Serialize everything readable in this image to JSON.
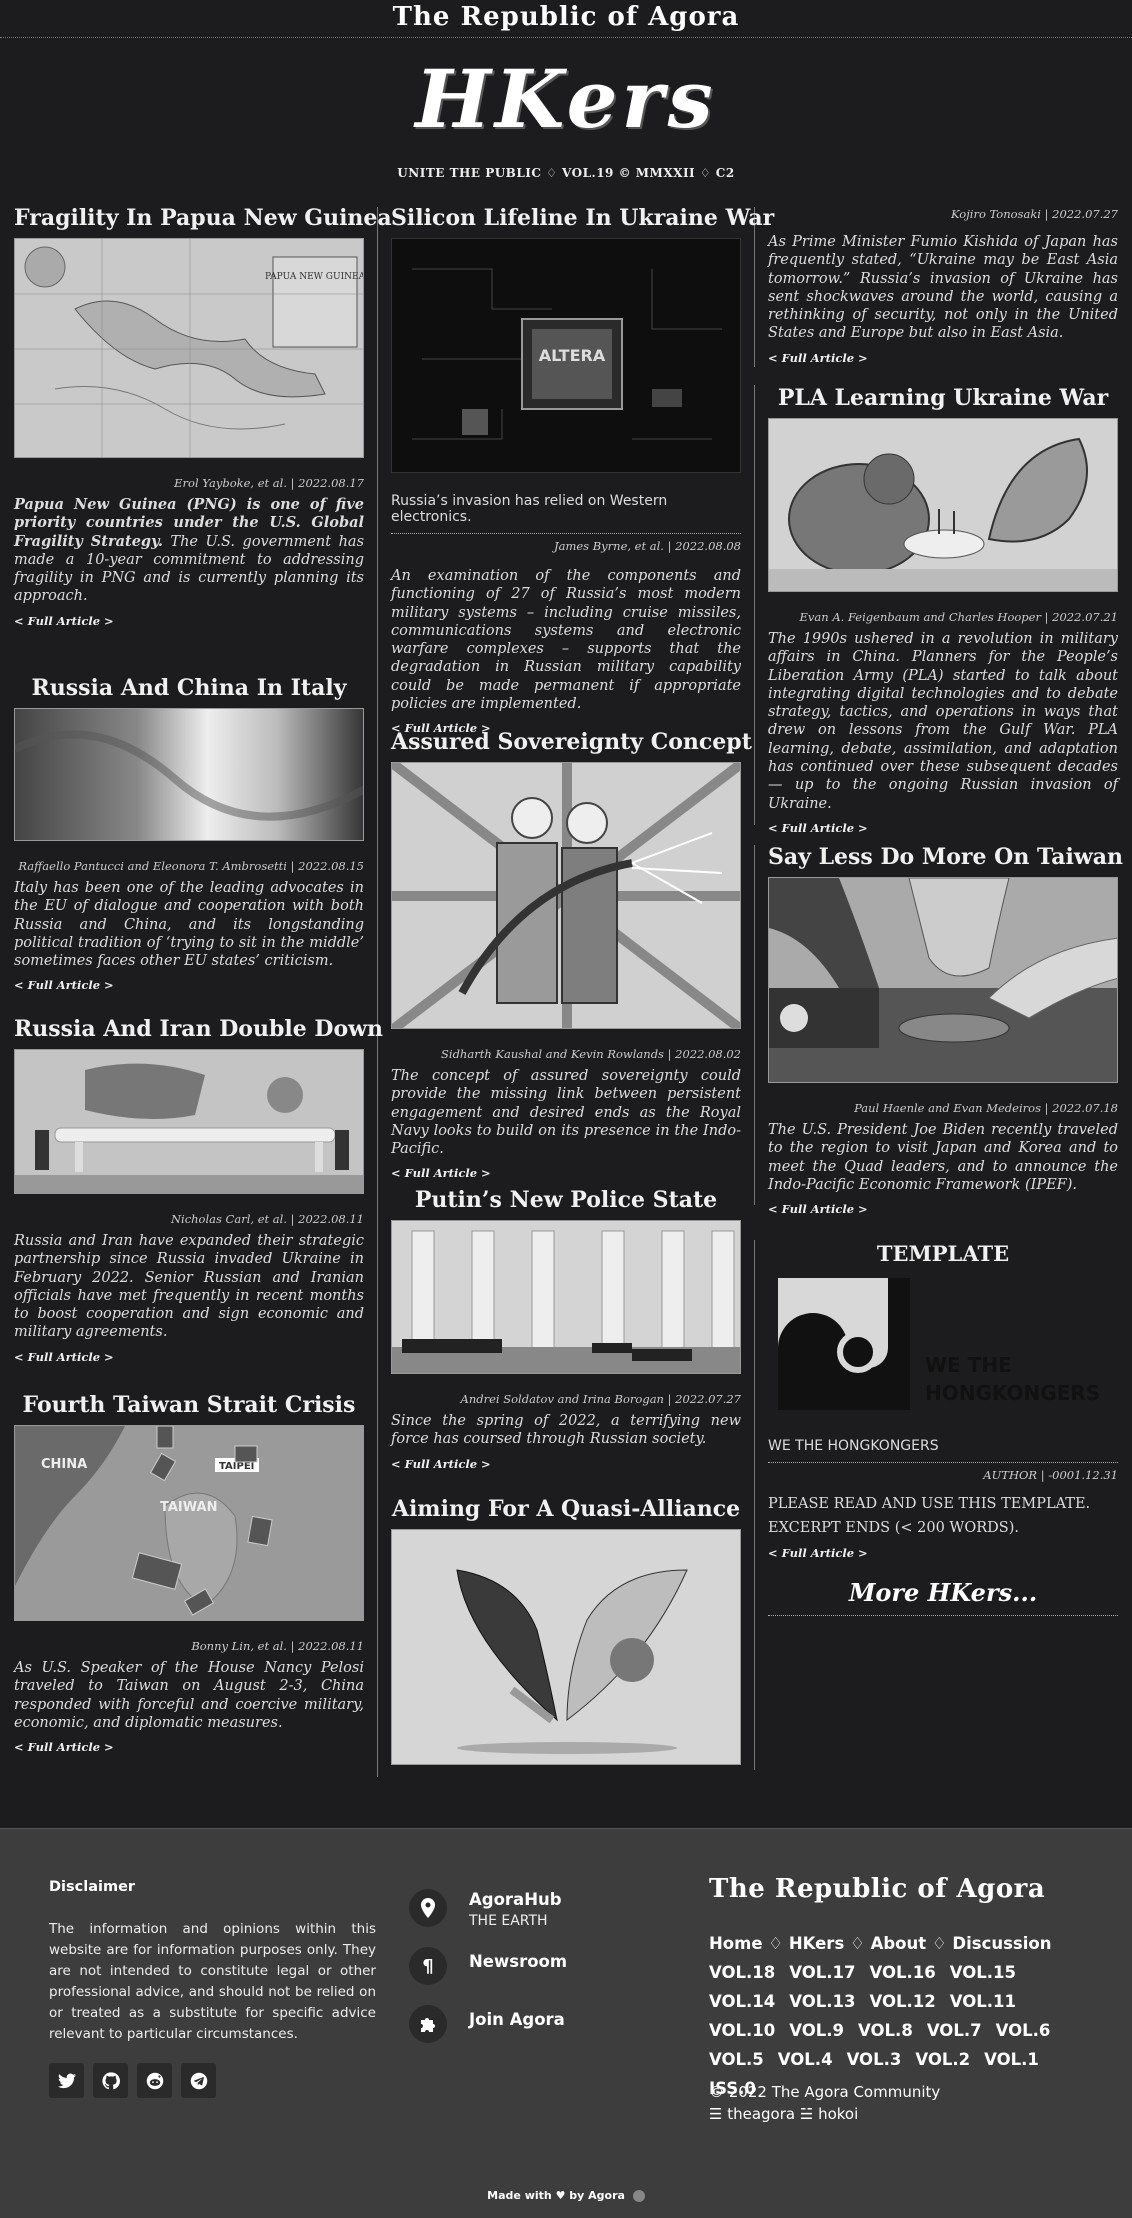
{
  "masthead": "The Republic of Agora",
  "logo": "HKers",
  "tagline": "UNITE THE PUBLIC ♢ VOL.19 © MMXXII ♢ C2",
  "full_article": "< Full Article >",
  "articles": {
    "a1": {
      "title": "Fragility In Papua New Guinea",
      "meta": "Erol Yayboke, et al. | 2022.08.17",
      "lead": "Papua New Guinea (PNG) is one of five priority countries under the U.S. Global Fragility Strategy.",
      "excerpt": "The U.S. government has made a 10-year commitment to addressing fragility in PNG and is currently planning its approach.",
      "map_title": "PAPUA NEW GUINEA"
    },
    "a2": {
      "title": "Russia And China In Italy",
      "meta": "Raffaello Pantucci and Eleonora T. Ambrosetti | 2022.08.15",
      "excerpt": "Italy has been one of the leading advocates in the EU of dialogue and cooperation with both Russia and China, and its longstanding political tradition of ‘trying to sit in the middle’ sometimes faces other EU states’ criticism."
    },
    "a3": {
      "title": "Russia And Iran Double Down",
      "meta": "Nicholas Carl, et al. | 2022.08.11",
      "excerpt": "Russia and Iran have expanded their strategic partnership since Russia invaded Ukraine in February 2022. Senior Russian and Iranian officials have met frequently in recent months to boost cooperation and sign economic and military agreements."
    },
    "a4": {
      "title": "Fourth Taiwan Strait Crisis",
      "meta": "Bonny Lin, et al. | 2022.08.11",
      "excerpt": "As U.S. Speaker of the House Nancy Pelosi traveled to Taiwan on August 2-3, China responded with forceful and coercive military, economic, and diplomatic measures.",
      "map_labels": [
        "CHINA",
        "TAIWAN",
        "TAIPEI"
      ]
    },
    "b1": {
      "title": "Silicon Lifeline In Ukraine War",
      "caption": "Russia’s invasion has relied on Western electronics.",
      "meta": "James Byrne, et al. | 2022.08.08",
      "excerpt": "An examination of the components and functioning of 27 of Russia’s most modern military systems – including cruise missiles, communications systems and electronic warfare complexes – supports that the degradation in Russian military capability could be made permanent if appropriate policies are implemented.",
      "chip_text": "ALTERA"
    },
    "b2": {
      "title": "Assured Sovereignty Concept",
      "meta": "Sidharth Kaushal and Kevin Rowlands | 2022.08.02",
      "excerpt": "The concept of assured sovereignty could provide the missing link between persistent engagement and desired ends as the Royal Navy looks to build on its presence in the Indo-Pacific."
    },
    "b3": {
      "title": "Putin’s New Police State",
      "meta": "Andrei Soldatov and Irina Borogan | 2022.07.27",
      "excerpt": "Since the spring of 2022, a terrifying new force has coursed through Russian society."
    },
    "b4": {
      "title": "Aiming For A Quasi-Alliance"
    },
    "c0": {
      "meta": "Kojiro Tonosaki | 2022.07.27",
      "excerpt": "As Prime Minister Fumio Kishida of Japan has frequently stated, “Ukraine may be East Asia tomorrow.” Russia’s invasion of Ukraine has sent shockwaves around the world, causing a rethinking of security, not only in the United States and Europe but also in East Asia."
    },
    "c1": {
      "title": "PLA Learning Ukraine War",
      "meta": "Evan A. Feigenbaum and Charles Hooper | 2022.07.21",
      "excerpt": "The 1990s ushered in a revolution in military affairs in China. Planners for the People’s Liberation Army (PLA) started to talk about integrating digital technologies and to debate strategy, tactics, and operations in ways that drew on lessons from the Gulf War. PLA learning, debate, assimilation, and adaptation has continued over these subsequent decades — up to the ongoing Russian invasion of Ukraine."
    },
    "c2": {
      "title": "Say Less Do More On Taiwan",
      "meta": "Paul Haenle and Evan Medeiros | 2022.07.18",
      "excerpt": "The U.S. President Joe Biden recently traveled to the region to visit Japan and Korea and to meet the Quad leaders, and to announce the Indo-Pacific Economic Framework (IPEF)."
    },
    "c3": {
      "title": "TEMPLATE",
      "logo_line1": "WE THE",
      "logo_line2": "HONGKONGERS",
      "caption": "WE THE HONGKONGERS",
      "meta": "AUTHOR | -0001.12.31",
      "body1": "PLEASE READ AND USE THIS TEMPLATE.",
      "body2": "EXCERPT ENDS (< 200 WORDS)."
    }
  },
  "more_hkers": "More HKers...",
  "footer": {
    "disclaimer_title": "Disclaimer",
    "disclaimer_text": "The information and opinions within this website are for information purposes only. They are not intended to constitute legal or other professional advice, and should not be relied on or treated as a substitute for specific advice relevant to particular circumstances.",
    "socials": [
      "twitter-icon",
      "github-icon",
      "reddit-icon",
      "telegram-icon"
    ],
    "hub": [
      {
        "title": "AgoraHub",
        "sub": "THE EARTH",
        "icon": "map-pin-icon"
      },
      {
        "title": "Newsroom",
        "icon": "pilcrow-icon"
      },
      {
        "title": "Join Agora",
        "icon": "puzzle-icon"
      }
    ],
    "agora_title": "The Republic of Agora",
    "nav": [
      "Home",
      "HKers",
      "About",
      "Discussion"
    ],
    "vols": [
      "VOL.18",
      "VOL.17",
      "VOL.16",
      "VOL.15",
      "VOL.14",
      "VOL.13",
      "VOL.12",
      "VOL.11",
      "VOL.10",
      "VOL.9",
      "VOL.8",
      "VOL.7",
      "VOL.6",
      "VOL.5",
      "VOL.4",
      "VOL.3",
      "VOL.2",
      "VOL.1",
      "ISS.0"
    ],
    "copyright": "© 2022 The Agora Community",
    "handles": "☰ theagora ☱ hokoi",
    "made_with": "Made with",
    "by_agora": "by Agora"
  }
}
